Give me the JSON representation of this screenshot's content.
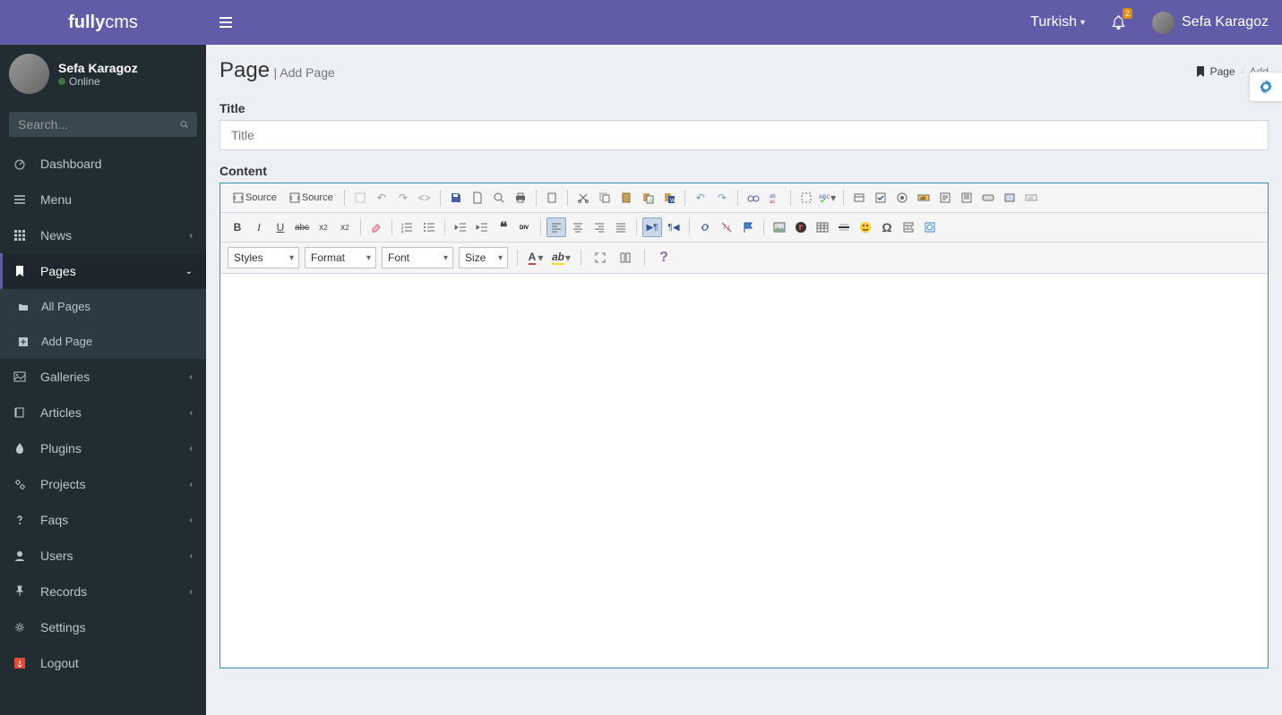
{
  "brand": {
    "bold": "fully",
    "light": "cms"
  },
  "header": {
    "language": "Turkish",
    "notification_count": "2",
    "user_name": "Sefa Karagoz"
  },
  "user_panel": {
    "name": "Sefa Karagoz",
    "status": "Online"
  },
  "search": {
    "placeholder": "Search..."
  },
  "sidebar": [
    {
      "icon": "dashboard",
      "label": "Dashboard",
      "expandable": false
    },
    {
      "icon": "bars",
      "label": "Menu",
      "expandable": false
    },
    {
      "icon": "th",
      "label": "News",
      "expandable": true
    },
    {
      "icon": "bookmark",
      "label": "Pages",
      "expandable": true,
      "active": true,
      "open": true,
      "children": [
        {
          "icon": "folder",
          "label": "All Pages"
        },
        {
          "icon": "plus-square",
          "label": "Add Page"
        }
      ]
    },
    {
      "icon": "picture",
      "label": "Galleries",
      "expandable": true
    },
    {
      "icon": "book",
      "label": "Articles",
      "expandable": true
    },
    {
      "icon": "tint",
      "label": "Plugins",
      "expandable": true
    },
    {
      "icon": "cogs",
      "label": "Projects",
      "expandable": true
    },
    {
      "icon": "question",
      "label": "Faqs",
      "expandable": true
    },
    {
      "icon": "user",
      "label": "Users",
      "expandable": true
    },
    {
      "icon": "thumbtack",
      "label": "Records",
      "expandable": true
    },
    {
      "icon": "cog",
      "label": "Settings",
      "expandable": false
    },
    {
      "icon": "logout",
      "label": "Logout",
      "expandable": false,
      "logout": true
    }
  ],
  "page": {
    "title": "Page",
    "subtitle": "| Add Page",
    "breadcrumb": {
      "item1": "Page",
      "item2": "Add"
    }
  },
  "form": {
    "title_label": "Title",
    "title_placeholder": "Title",
    "content_label": "Content"
  },
  "editor_dropdowns": {
    "styles": "Styles",
    "format": "Format",
    "font": "Font",
    "size": "Size"
  },
  "editor_labels": {
    "source1": "Source",
    "source2": "Source"
  }
}
